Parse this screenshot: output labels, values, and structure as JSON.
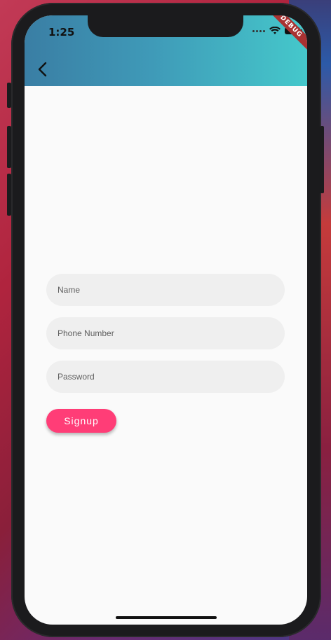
{
  "status_bar": {
    "time": "1:25",
    "debug_banner": "DEBUG"
  },
  "app_bar": {
    "back_icon": "chevron-left-icon",
    "gradient_start": "#3a7ea4",
    "gradient_end": "#45c8cb"
  },
  "form": {
    "name_placeholder": "Name",
    "phone_placeholder": "Phone Number",
    "password_placeholder": "Password",
    "signup_label": "Signup",
    "signup_color": "#ff3d77"
  }
}
